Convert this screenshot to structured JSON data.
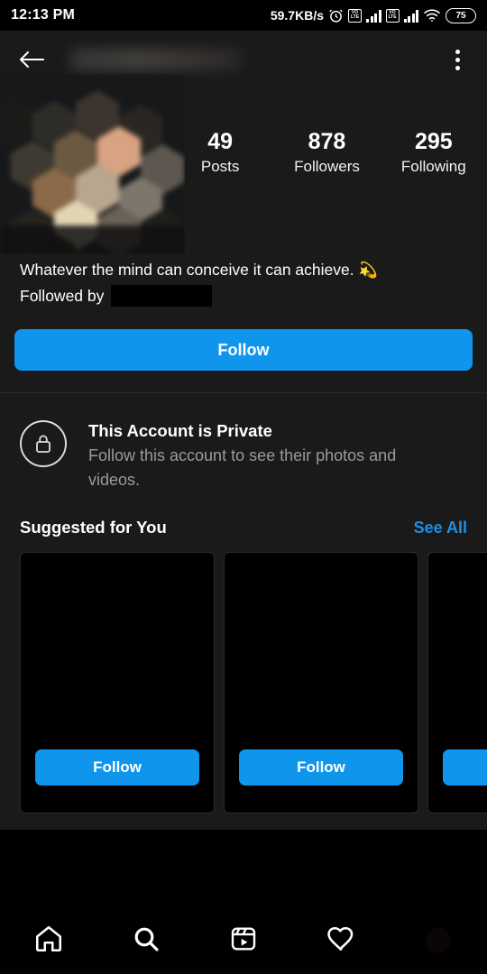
{
  "status_bar": {
    "clock": "12:13 PM",
    "network_speed": "59.7KB/s",
    "alarm_icon": "alarm-icon",
    "volte_label_top": "VO",
    "volte_label_bottom": "LTE",
    "sim1_icon": "signal-bars-icon",
    "sim2_icon": "signal-bars-icon",
    "wifi_icon": "wifi-icon",
    "battery_level": "75"
  },
  "app_bar": {
    "back_icon": "back-arrow-icon",
    "username": "",
    "menu_icon": "kebab-menu-icon"
  },
  "profile": {
    "avatar_name": "profile-avatar",
    "stats": [
      {
        "value": "49",
        "label": "Posts"
      },
      {
        "value": "878",
        "label": "Followers"
      },
      {
        "value": "295",
        "label": "Following"
      }
    ],
    "bio": "Whatever the mind can conceive it can achieve.",
    "bio_emoji": "💫",
    "followed_by_label": "Followed by",
    "followed_by_value": ""
  },
  "follow_button": {
    "label": "Follow"
  },
  "private_notice": {
    "lock_icon": "lock-icon",
    "title": "This Account is Private",
    "subtitle": "Follow this account to see their photos and videos."
  },
  "suggested": {
    "title": "Suggested for You",
    "see_all": "See All",
    "cards": [
      {
        "username": "",
        "follow_label": "Follow"
      },
      {
        "username": "",
        "follow_label": "Follow"
      },
      {
        "username": "",
        "follow_label": ""
      }
    ]
  },
  "bottom_nav": {
    "items": [
      {
        "name": "home-icon",
        "label": "Home"
      },
      {
        "name": "search-icon",
        "label": "Search"
      },
      {
        "name": "reels-icon",
        "label": "Reels"
      },
      {
        "name": "heart-icon",
        "label": "Activity"
      },
      {
        "name": "profile-avatar-icon",
        "label": "Profile"
      }
    ]
  },
  "colors": {
    "accent_blue": "#0F95EC",
    "link_blue": "#1E8FE5",
    "sheet_bg": "#1a1a1a",
    "page_bg": "#000000",
    "muted_text": "#9a9a9a"
  }
}
